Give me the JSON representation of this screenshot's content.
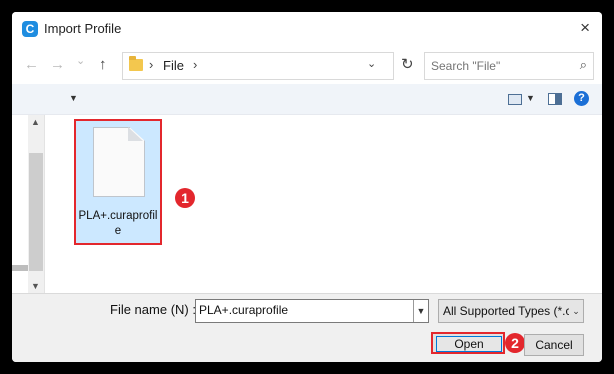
{
  "window": {
    "title": "Import Profile",
    "app_icon_letter": "C",
    "close_glyph": "×"
  },
  "address_bar": {
    "back_glyph": "←",
    "forward_glyph": "→",
    "recent_glyph": "⌄",
    "up_glyph": "↑",
    "separator": "›",
    "breadcrumb": [
      "File"
    ],
    "dropdown_glyph": "⌄",
    "refresh_glyph": "↻",
    "search_placeholder": "Search \"File\"",
    "search_icon_glyph": "⌕"
  },
  "toolbar": {
    "organize_dropdown_glyph": "▼",
    "view_dropdown_glyph": "▼",
    "help_label": "?"
  },
  "files": [
    {
      "name": "PLA+.curaprofile",
      "selected": true,
      "highlighted": true
    }
  ],
  "annotations": {
    "step1": "1",
    "step2": "2",
    "highlight_color": "#e3272d"
  },
  "bottom": {
    "file_name_label": "File name (N) :",
    "file_name_value": "PLA+.curaprofile",
    "file_type_value": "All Supported Types (*.curaprofile)",
    "open_label": "Open",
    "cancel_label": "Cancel"
  },
  "colors": {
    "accent": "#0078d7",
    "selection": "#cce8ff",
    "annotation_red": "#e3272d"
  }
}
